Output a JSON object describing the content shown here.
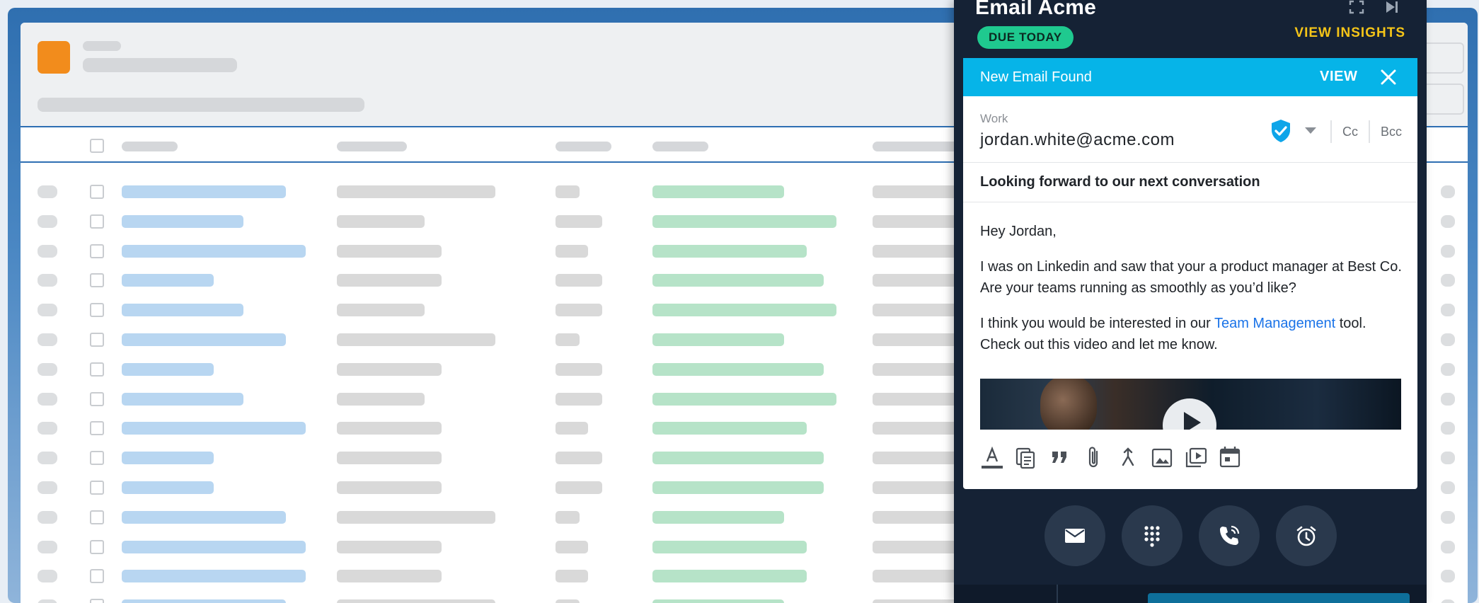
{
  "panel": {
    "title": "Email Acme",
    "due_badge": "DUE TODAY",
    "view_insights": "VIEW INSIGHTS"
  },
  "notice": {
    "text": "New Email Found",
    "view_label": "VIEW"
  },
  "composer": {
    "to_label": "Work",
    "to_value": "jordan.white@acme.com",
    "cc_label": "Cc",
    "bcc_label": "Bcc",
    "subject": "Looking forward to our next conversation",
    "greeting": "Hey Jordan,",
    "paragraph1": "I was on Linkedin and saw that your a product manager at Best Co. Are your teams running as smoothly as you’d like?",
    "paragraph2_before": "I think you would be interested in our ",
    "paragraph2_link": "Team Management",
    "paragraph2_after": " tool. Check out this video and let me know."
  },
  "toolbar_icons": [
    "text-color-icon",
    "template-icon",
    "quote-icon",
    "attachment-icon",
    "merge-field-icon",
    "image-icon",
    "video-icon",
    "calendar-icon"
  ],
  "action_icons": [
    "email-icon",
    "dialpad-icon",
    "call-icon",
    "alarm-icon"
  ],
  "colors": {
    "brand_orange": "#f28c1c",
    "panel_dark": "#152235",
    "notice_blue": "#06b4e8",
    "due_green": "#1fc98f",
    "insights_yellow": "#f5c518",
    "link_blue": "#1a73e8"
  }
}
